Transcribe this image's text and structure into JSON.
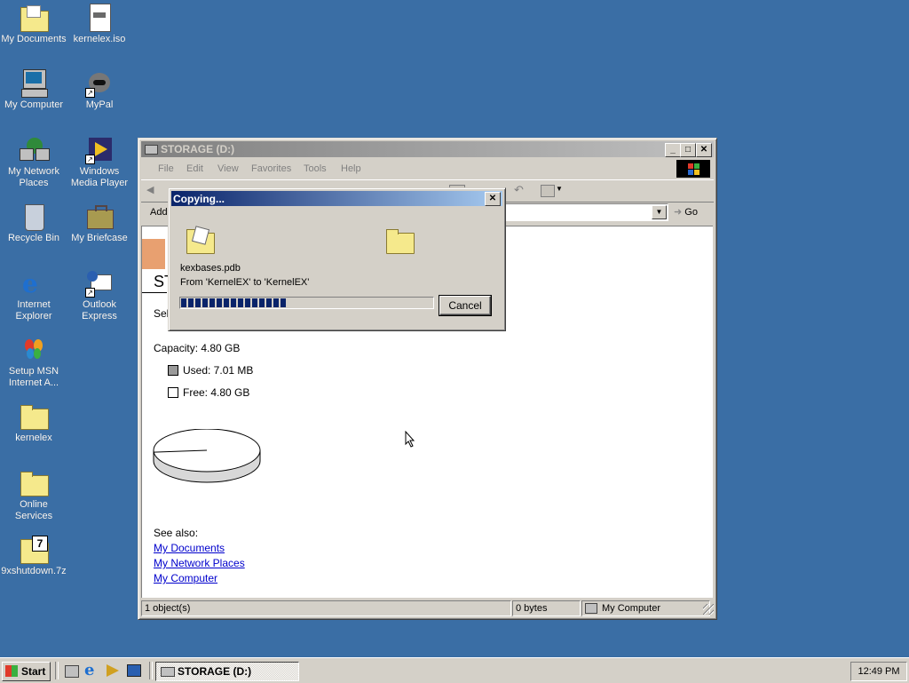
{
  "desktop_icons": [
    {
      "label": "My Documents",
      "icon": "folder-documents-icon"
    },
    {
      "label": "kernelex.iso",
      "icon": "iso-file-icon"
    },
    {
      "label": "My Computer",
      "icon": "computer-icon"
    },
    {
      "label": "MyPal",
      "icon": "mypal-icon"
    },
    {
      "label": "My Network Places",
      "icon": "network-places-icon"
    },
    {
      "label": "Windows Media Player",
      "icon": "media-player-icon"
    },
    {
      "label": "Recycle Bin",
      "icon": "recycle-bin-icon"
    },
    {
      "label": "My Briefcase",
      "icon": "briefcase-icon"
    },
    {
      "label": "Internet Explorer",
      "icon": "ie-icon"
    },
    {
      "label": "Outlook Express",
      "icon": "outlook-icon"
    },
    {
      "label": "Setup MSN Internet A...",
      "icon": "msn-icon"
    },
    {
      "label": "kernelex",
      "icon": "folder-icon"
    },
    {
      "label": "Online Services",
      "icon": "folder-icon"
    },
    {
      "label": "9xshutdown.7z",
      "icon": "7z-archive-icon"
    }
  ],
  "window": {
    "title": "STORAGE (D:)",
    "menu": [
      "File",
      "Edit",
      "View",
      "Favorites",
      "Tools",
      "Help"
    ],
    "address_label": "Add",
    "go_label": "Go",
    "content": {
      "heading_partial": "ST",
      "select_partial": "Sel",
      "capacity": "Capacity: 4.80 GB",
      "used": "Used: 7.01 MB",
      "free": "Free: 4.80 GB",
      "used_fraction": 0.0014,
      "see_also": "See also:",
      "links": [
        "My Documents",
        "My Network Places",
        "My Computer"
      ]
    },
    "status": {
      "objects": "1 object(s)",
      "size": "0 bytes",
      "zone": "My Computer"
    }
  },
  "dialog": {
    "title": "Copying...",
    "filename": "kexbases.pdb",
    "from_to": "From 'KernelEX' to 'KernelEX'",
    "progress_fraction": 0.42,
    "cancel_label": "Cancel"
  },
  "taskbar": {
    "start_label": "Start",
    "task_label": "STORAGE (D:)",
    "clock": "12:49 PM"
  }
}
